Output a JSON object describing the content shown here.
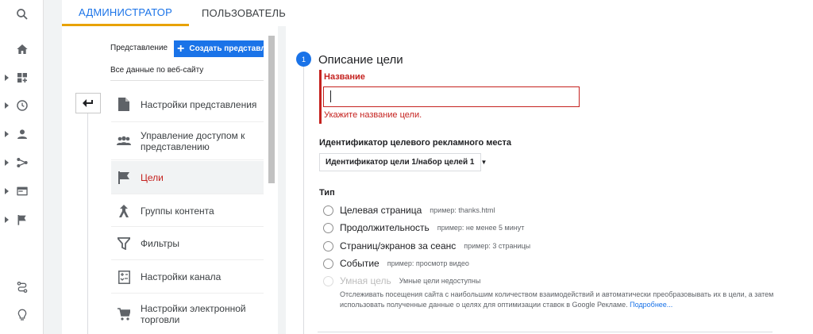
{
  "tabs": {
    "admin": "АДМИНИСТРАТОР",
    "user": "ПОЛЬЗОВАТЕЛЬ"
  },
  "rail": {
    "icons": [
      "search-icon",
      "home-icon",
      "customization-icon",
      "realtime-clock-icon",
      "audience-person-icon",
      "acquisition-icon",
      "behavior-icon",
      "conversions-flag-icon",
      "attribution-icon",
      "lightbulb-icon"
    ]
  },
  "view_panel": {
    "label": "Представление",
    "create_button": "Создать представление",
    "selected_view": "Все данные по веб-сайту"
  },
  "menu": {
    "items": [
      {
        "label": "Настройки представления",
        "icon": "document-icon"
      },
      {
        "label": "Управление доступом к представлению",
        "icon": "people-icon"
      },
      {
        "label": "Цели",
        "icon": "flag-icon"
      },
      {
        "label": "Группы контента",
        "icon": "content-groups-icon"
      },
      {
        "label": "Фильтры",
        "icon": "filter-icon"
      },
      {
        "label": "Настройки канала",
        "icon": "channel-settings-icon"
      },
      {
        "label": "Настройки электронной торговли",
        "icon": "cart-icon"
      }
    ]
  },
  "form": {
    "step_number": "1",
    "step_title": "Описание цели",
    "name_label": "Название",
    "name_value": "",
    "name_error": "Укажите название цели.",
    "slot_label": "Идентификатор целевого рекламного места",
    "slot_value": "Идентификатор цели 1/набор целей 1",
    "type_label": "Тип",
    "types": [
      {
        "label": "Целевая страница",
        "example": "пример: thanks.html"
      },
      {
        "label": "Продолжительность",
        "example": "пример: не менее 5 минут"
      },
      {
        "label": "Страниц/экранов за сеанс",
        "example": "пример: 3 страницы"
      },
      {
        "label": "Событие",
        "example": "пример: просмотр видео"
      },
      {
        "label": "Умная цель",
        "example": "Умные цели недоступны"
      }
    ],
    "smart_description": "Отслеживать посещения сайта с наибольшим количеством взаимодействий и автоматически преобразовывать их в цели, а затем использовать полученные данные о целях для оптимизации ставок в Google Рекламе.",
    "learn_more": "Подробнее..."
  },
  "colors": {
    "accent_blue": "#1a73e8",
    "error_red": "#c5221f",
    "tab_underline": "#e8a200"
  }
}
